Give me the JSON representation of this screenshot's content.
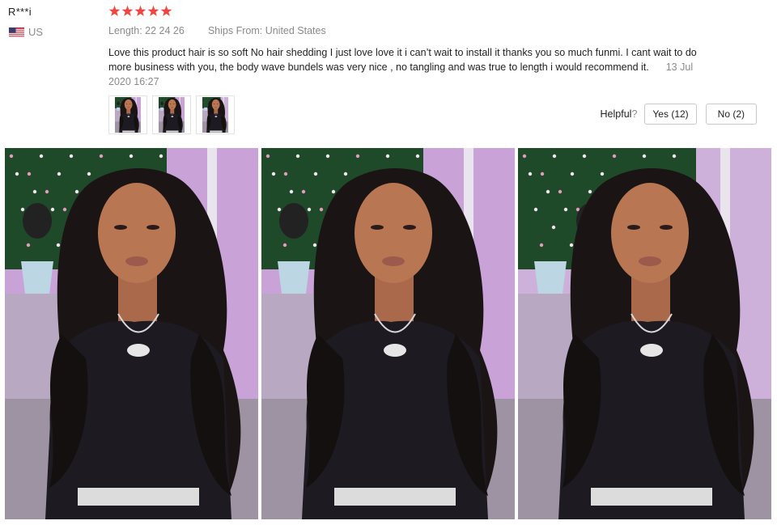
{
  "review": {
    "user": {
      "name": "R***i",
      "country_code": "US",
      "flag_icon": "us-flag-icon"
    },
    "rating": {
      "stars": 5,
      "max": 5,
      "color": "#f0463f"
    },
    "length_text": "Length: 22 24 26",
    "ships_from_text": "Ships From: United States",
    "text": "Love this product hair is so soft No hair shedding I just love love it i can’t wait to install it thanks you so much funmi. I cant wait to do more business with you, the body wave bundels was very nice , no tangling and was true to length i would recommend it.",
    "date": "13 Jul 2020 16:27",
    "helpful": {
      "label": "Helpful",
      "question_mark": "?",
      "yes_label": "Yes (12)",
      "no_label": "No (2)"
    },
    "thumbnail_count": 3,
    "photo_count": 3
  },
  "colors": {
    "star": "#f0463f",
    "muted_text": "#8a8a8a",
    "button_border": "#c9c9c9"
  }
}
